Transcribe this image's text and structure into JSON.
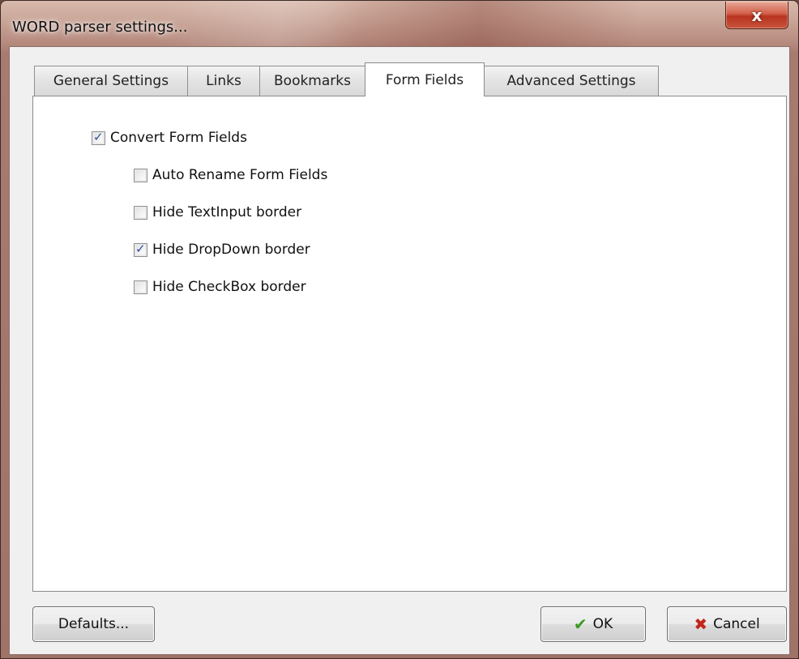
{
  "window": {
    "title": "WORD parser settings...",
    "close_glyph": "x"
  },
  "tabs": [
    {
      "label": "General Settings",
      "active": false
    },
    {
      "label": "Links",
      "active": false
    },
    {
      "label": "Bookmarks",
      "active": false
    },
    {
      "label": "Form Fields",
      "active": true
    },
    {
      "label": "Advanced Settings",
      "active": false
    }
  ],
  "form_fields": {
    "convert": {
      "label": "Convert Form Fields",
      "checked": true
    },
    "options": [
      {
        "label": "Auto Rename Form Fields",
        "checked": false
      },
      {
        "label": "Hide TextInput border",
        "checked": false
      },
      {
        "label": "Hide DropDown border",
        "checked": true
      },
      {
        "label": "Hide CheckBox border",
        "checked": false
      }
    ]
  },
  "buttons": {
    "defaults": "Defaults...",
    "ok": "OK",
    "cancel": "Cancel",
    "ok_icon": "checkmark-icon",
    "cancel_icon": "x-icon"
  },
  "colors": {
    "titlebar": "#b98e82",
    "close_button": "#c9553c",
    "check": "#2f4f9a",
    "ok_icon": "#3a9a1e",
    "cancel_icon": "#c2261b"
  }
}
